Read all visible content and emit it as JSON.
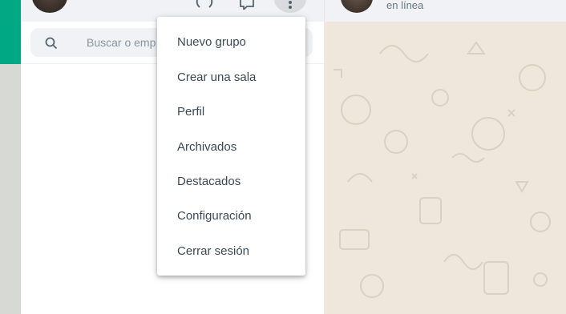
{
  "search": {
    "placeholder": "Buscar o emp"
  },
  "chat": {
    "status": "en línea"
  },
  "menu": {
    "items": [
      {
        "label": "Nuevo grupo"
      },
      {
        "label": "Crear una sala"
      },
      {
        "label": "Perfil"
      },
      {
        "label": "Archivados"
      },
      {
        "label": "Destacados"
      },
      {
        "label": "Configuración"
      },
      {
        "label": "Cerrar sesión"
      }
    ]
  },
  "colors": {
    "accent": "#00a884",
    "chat_background": "#efe7dc",
    "panel_header": "#f0f2f5",
    "menu_text": "#3b4a54"
  },
  "icons": {
    "header": [
      "status-icon",
      "new-chat-icon",
      "menu-icon"
    ],
    "search": "search-icon"
  }
}
